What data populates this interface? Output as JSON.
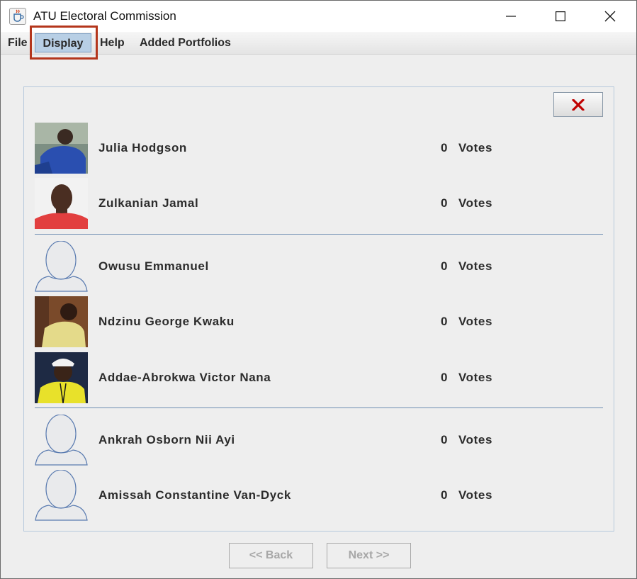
{
  "window": {
    "title": "ATU Electoral Commission",
    "icon": "java-cup-icon",
    "controls": [
      "minimize-icon",
      "maximize-icon",
      "close-icon"
    ]
  },
  "menu": {
    "file": "File",
    "display": "Display",
    "help": "Help",
    "added_portfolios": "Added Portfolios",
    "highlighted": "Display",
    "highlight_color": "#b4361c"
  },
  "panel": {
    "close_icon": "red-x-icon",
    "close_color": "#c00000"
  },
  "candidates": [
    {
      "name": "Julia Hodgson",
      "votes": "0",
      "votes_label": "Votes",
      "photo": "photo-blue-shirt"
    },
    {
      "name": "Zulkanian Jamal",
      "votes": "0",
      "votes_label": "Votes",
      "photo": "photo-red-shirt"
    },
    {
      "name": "Owusu Emmanuel",
      "votes": "0",
      "votes_label": "Votes",
      "photo": "default-avatar"
    },
    {
      "name": "Ndzinu George Kwaku",
      "votes": "0",
      "votes_label": "Votes",
      "photo": "photo-yellow-shirt"
    },
    {
      "name": "Addae-Abrokwa Victor Nana",
      "votes": "0",
      "votes_label": "Votes",
      "photo": "photo-yellow-jacket"
    },
    {
      "name": "Ankrah Osborn Nii Ayi",
      "votes": "0",
      "votes_label": "Votes",
      "photo": "default-avatar"
    },
    {
      "name": "Amissah Constantine Van-Dyck",
      "votes": "0",
      "votes_label": "Votes",
      "photo": "default-avatar"
    }
  ],
  "nav": {
    "back": "<< Back",
    "next": "Next >>",
    "back_enabled": false,
    "next_enabled": false
  }
}
